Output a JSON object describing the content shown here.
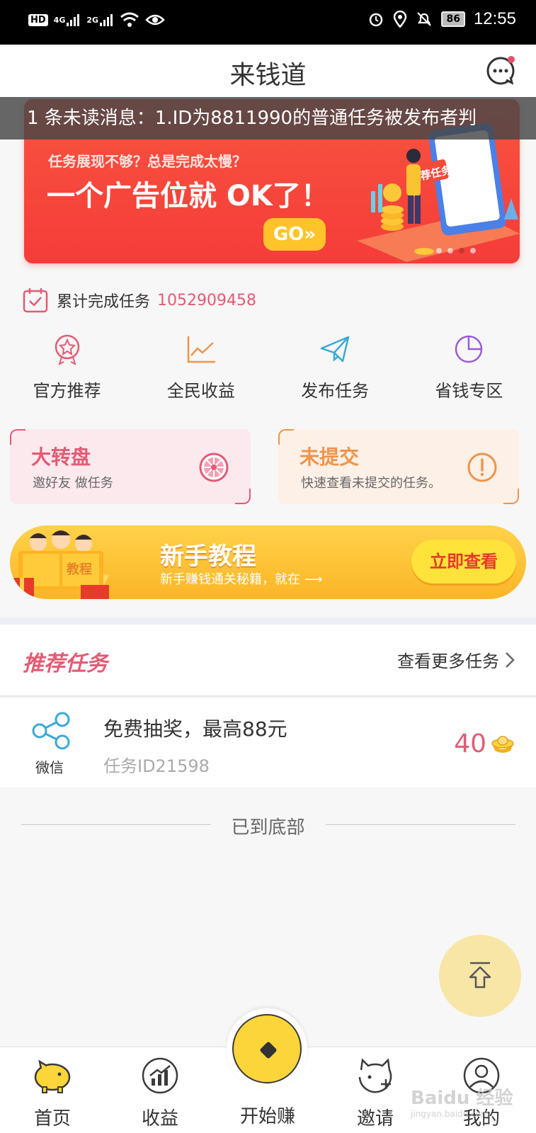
{
  "status_bar": {
    "left_badges": [
      "HD",
      "4G",
      "2G"
    ],
    "battery": "86",
    "time": "12:55"
  },
  "header": {
    "title": "来钱道"
  },
  "notice": {
    "text": "1 条未读消息：1.ID为8811990的普通任务被发布者判"
  },
  "banner": {
    "line1": "任务展现不够？总是完成太慢？",
    "line2": "一个广告位就 OK了！",
    "go_label": "GO»",
    "art_label": "推荐任务",
    "dot_count": 4,
    "active_dot": 3
  },
  "stats": {
    "label": "累计完成任务",
    "value": "1052909458"
  },
  "quick_grid": [
    {
      "label": "官方推荐",
      "icon": "badge-icon",
      "color": "#e35b74"
    },
    {
      "label": "全民收益",
      "icon": "chart-line-icon",
      "color": "#f0944a"
    },
    {
      "label": "发布任务",
      "icon": "paper-plane-icon",
      "color": "#3aa9d8"
    },
    {
      "label": "省钱专区",
      "icon": "pie-chart-icon",
      "color": "#9a5ad8"
    }
  ],
  "cards": {
    "spin": {
      "title": "大转盘",
      "subtitle": "邀好友  做任务"
    },
    "unsubmitted": {
      "title": "未提交",
      "subtitle": "快速查看未提交的任务。"
    }
  },
  "tutorial": {
    "art_label": "教程",
    "title": "新手教程",
    "subtitle": "新手赚钱通关秘籍，就在 ⟶",
    "button": "立即查看"
  },
  "recommended": {
    "title": "推荐任务",
    "more": "查看更多任务"
  },
  "tasks": [
    {
      "platform": "微信",
      "title": "免费抽奖，最高88元",
      "id": "任务ID21598",
      "reward": "40"
    }
  ],
  "end_text": "已到底部",
  "bottom_nav": {
    "home": "首页",
    "earnings": "收益",
    "start": "开始赚",
    "invite": "邀请",
    "mine": "我的"
  },
  "watermark": {
    "text": "Baidu 经验",
    "sub": "jingyan.baidu.com"
  },
  "colors": {
    "accent_pink": "#e35b74",
    "accent_orange": "#f0944a",
    "yellow": "#fcd53a"
  }
}
